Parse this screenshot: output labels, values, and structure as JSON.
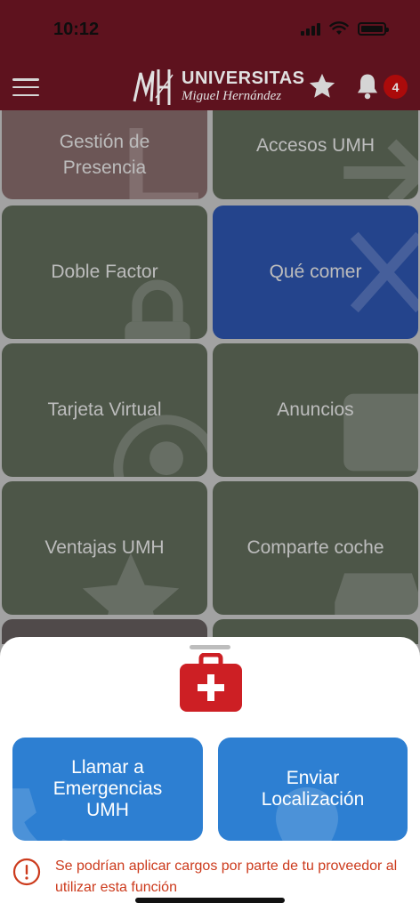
{
  "status_bar": {
    "time": "10:12"
  },
  "header": {
    "logo_line1": "UNIVERSITAS",
    "logo_line2": "Miguel Hernández",
    "notification_count": "4"
  },
  "tiles": [
    {
      "label_line1": "Gestión de",
      "label_line2": "Presencia",
      "icon": "calendar-icon"
    },
    {
      "label": "Accesos UMH",
      "icon": "arrow-right-icon"
    },
    {
      "label": "Doble Factor",
      "icon": "lock-icon"
    },
    {
      "label": "Qué comer",
      "icon": "utensils-icon"
    },
    {
      "label": "Tarjeta Virtual",
      "icon": "user-circle-icon"
    },
    {
      "label": "Anuncios",
      "icon": "newspaper-icon"
    },
    {
      "label": "Ventajas UMH",
      "icon": "star-icon"
    },
    {
      "label": "Comparte coche",
      "icon": "car-icon"
    }
  ],
  "colors": {
    "header": "#6b1523",
    "tile_default": "#586253",
    "tile_highlight": "#2a4ea0",
    "tile_presencia": "#7c6262",
    "action_button": "#2d7fd2",
    "warning_text": "#cc3a1c",
    "kit_icon": "#cd1f24"
  },
  "sheet": {
    "call_button_line1": "Llamar a",
    "call_button_line2": "Emergencias",
    "call_button_line3": "UMH",
    "location_button_line1": "Enviar",
    "location_button_line2": "Localización",
    "warning_text": "Se podrían aplicar cargos por parte de tu proveedor al utilizar esta función"
  }
}
